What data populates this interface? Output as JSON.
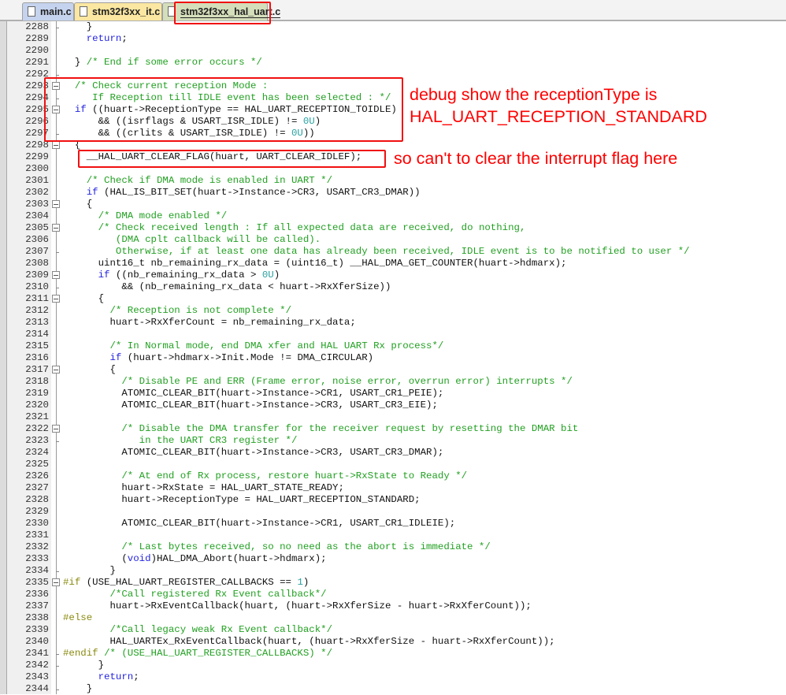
{
  "tabs": [
    {
      "label": "main.c",
      "active": false,
      "color": "#c5d3ee"
    },
    {
      "label": "stm32f3xx_it.c",
      "active": false,
      "color": "#fbe7a1"
    },
    {
      "label": "stm32f3xx_hal_uart.c",
      "active": true,
      "color": "#d4deba"
    }
  ],
  "annotations": {
    "reception_note_line1": "debug show the receptionType is",
    "reception_note_line2": "HAL_UART_RECEPTION_STANDARD",
    "clear_flag_note": "so can't to clear the interrupt flag here",
    "highlight_color": "#f01010"
  },
  "code_lines": [
    {
      "n": "2288",
      "fold": "end",
      "t": "    }"
    },
    {
      "n": "2289",
      "fold": "",
      "t": "    return;"
    },
    {
      "n": "2290",
      "fold": "",
      "t": ""
    },
    {
      "n": "2291",
      "fold": "",
      "t": "  } /* End if some error occurs */"
    },
    {
      "n": "2292",
      "fold": "end",
      "t": ""
    },
    {
      "n": "2293",
      "fold": "box",
      "t": "  /* Check current reception Mode :"
    },
    {
      "n": "2294",
      "fold": "end",
      "t": "     If Reception till IDLE event has been selected : */"
    },
    {
      "n": "2295",
      "fold": "box",
      "t": "  if ((huart->ReceptionType == HAL_UART_RECEPTION_TOIDLE)"
    },
    {
      "n": "2296",
      "fold": "",
      "t": "      && ((isrflags & USART_ISR_IDLE) != 0U)"
    },
    {
      "n": "2297",
      "fold": "end",
      "t": "      && ((crlits & USART_ISR_IDLE) != 0U))"
    },
    {
      "n": "2298",
      "fold": "box",
      "t": "  {"
    },
    {
      "n": "2299",
      "fold": "",
      "t": "    __HAL_UART_CLEAR_FLAG(huart, UART_CLEAR_IDLEF);"
    },
    {
      "n": "2300",
      "fold": "",
      "t": ""
    },
    {
      "n": "2301",
      "fold": "",
      "t": "    /* Check if DMA mode is enabled in UART */"
    },
    {
      "n": "2302",
      "fold": "",
      "t": "    if (HAL_IS_BIT_SET(huart->Instance->CR3, USART_CR3_DMAR))"
    },
    {
      "n": "2303",
      "fold": "box",
      "t": "    {"
    },
    {
      "n": "2304",
      "fold": "",
      "t": "      /* DMA mode enabled */"
    },
    {
      "n": "2305",
      "fold": "box",
      "t": "      /* Check received length : If all expected data are received, do nothing,"
    },
    {
      "n": "2306",
      "fold": "",
      "t": "         (DMA cplt callback will be called)."
    },
    {
      "n": "2307",
      "fold": "end",
      "t": "         Otherwise, if at least one data has already been received, IDLE event is to be notified to user */"
    },
    {
      "n": "2308",
      "fold": "",
      "t": "      uint16_t nb_remaining_rx_data = (uint16_t) __HAL_DMA_GET_COUNTER(huart->hdmarx);"
    },
    {
      "n": "2309",
      "fold": "box",
      "t": "      if ((nb_remaining_rx_data > 0U)"
    },
    {
      "n": "2310",
      "fold": "end",
      "t": "          && (nb_remaining_rx_data < huart->RxXferSize))"
    },
    {
      "n": "2311",
      "fold": "box",
      "t": "      {"
    },
    {
      "n": "2312",
      "fold": "",
      "t": "        /* Reception is not complete */"
    },
    {
      "n": "2313",
      "fold": "",
      "t": "        huart->RxXferCount = nb_remaining_rx_data;"
    },
    {
      "n": "2314",
      "fold": "",
      "t": ""
    },
    {
      "n": "2315",
      "fold": "",
      "t": "        /* In Normal mode, end DMA xfer and HAL UART Rx process*/"
    },
    {
      "n": "2316",
      "fold": "",
      "t": "        if (huart->hdmarx->Init.Mode != DMA_CIRCULAR)"
    },
    {
      "n": "2317",
      "fold": "box",
      "t": "        {"
    },
    {
      "n": "2318",
      "fold": "",
      "t": "          /* Disable PE and ERR (Frame error, noise error, overrun error) interrupts */"
    },
    {
      "n": "2319",
      "fold": "",
      "t": "          ATOMIC_CLEAR_BIT(huart->Instance->CR1, USART_CR1_PEIE);"
    },
    {
      "n": "2320",
      "fold": "",
      "t": "          ATOMIC_CLEAR_BIT(huart->Instance->CR3, USART_CR3_EIE);"
    },
    {
      "n": "2321",
      "fold": "",
      "t": ""
    },
    {
      "n": "2322",
      "fold": "box",
      "t": "          /* Disable the DMA transfer for the receiver request by resetting the DMAR bit"
    },
    {
      "n": "2323",
      "fold": "end",
      "t": "             in the UART CR3 register */"
    },
    {
      "n": "2324",
      "fold": "",
      "t": "          ATOMIC_CLEAR_BIT(huart->Instance->CR3, USART_CR3_DMAR);"
    },
    {
      "n": "2325",
      "fold": "",
      "t": ""
    },
    {
      "n": "2326",
      "fold": "",
      "t": "          /* At end of Rx process, restore huart->RxState to Ready */"
    },
    {
      "n": "2327",
      "fold": "",
      "t": "          huart->RxState = HAL_UART_STATE_READY;"
    },
    {
      "n": "2328",
      "fold": "",
      "t": "          huart->ReceptionType = HAL_UART_RECEPTION_STANDARD;"
    },
    {
      "n": "2329",
      "fold": "",
      "t": ""
    },
    {
      "n": "2330",
      "fold": "",
      "t": "          ATOMIC_CLEAR_BIT(huart->Instance->CR1, USART_CR1_IDLEIE);"
    },
    {
      "n": "2331",
      "fold": "",
      "t": ""
    },
    {
      "n": "2332",
      "fold": "",
      "t": "          /* Last bytes received, so no need as the abort is immediate */"
    },
    {
      "n": "2333",
      "fold": "",
      "t": "          (void)HAL_DMA_Abort(huart->hdmarx);"
    },
    {
      "n": "2334",
      "fold": "end",
      "t": "        }"
    },
    {
      "n": "2335",
      "fold": "box",
      "t": "#if (USE_HAL_UART_REGISTER_CALLBACKS == 1)"
    },
    {
      "n": "2336",
      "fold": "",
      "t": "        /*Call registered Rx Event callback*/"
    },
    {
      "n": "2337",
      "fold": "",
      "t": "        huart->RxEventCallback(huart, (huart->RxXferSize - huart->RxXferCount));"
    },
    {
      "n": "2338",
      "fold": "",
      "t": "#else"
    },
    {
      "n": "2339",
      "fold": "",
      "t": "        /*Call legacy weak Rx Event callback*/"
    },
    {
      "n": "2340",
      "fold": "",
      "t": "        HAL_UARTEx_RxEventCallback(huart, (huart->RxXferSize - huart->RxXferCount));"
    },
    {
      "n": "2341",
      "fold": "end",
      "t": "#endif /* (USE_HAL_UART_REGISTER_CALLBACKS) */"
    },
    {
      "n": "2342",
      "fold": "end",
      "t": "      }"
    },
    {
      "n": "2343",
      "fold": "",
      "t": "      return;"
    },
    {
      "n": "2344",
      "fold": "end",
      "t": "    }"
    }
  ]
}
